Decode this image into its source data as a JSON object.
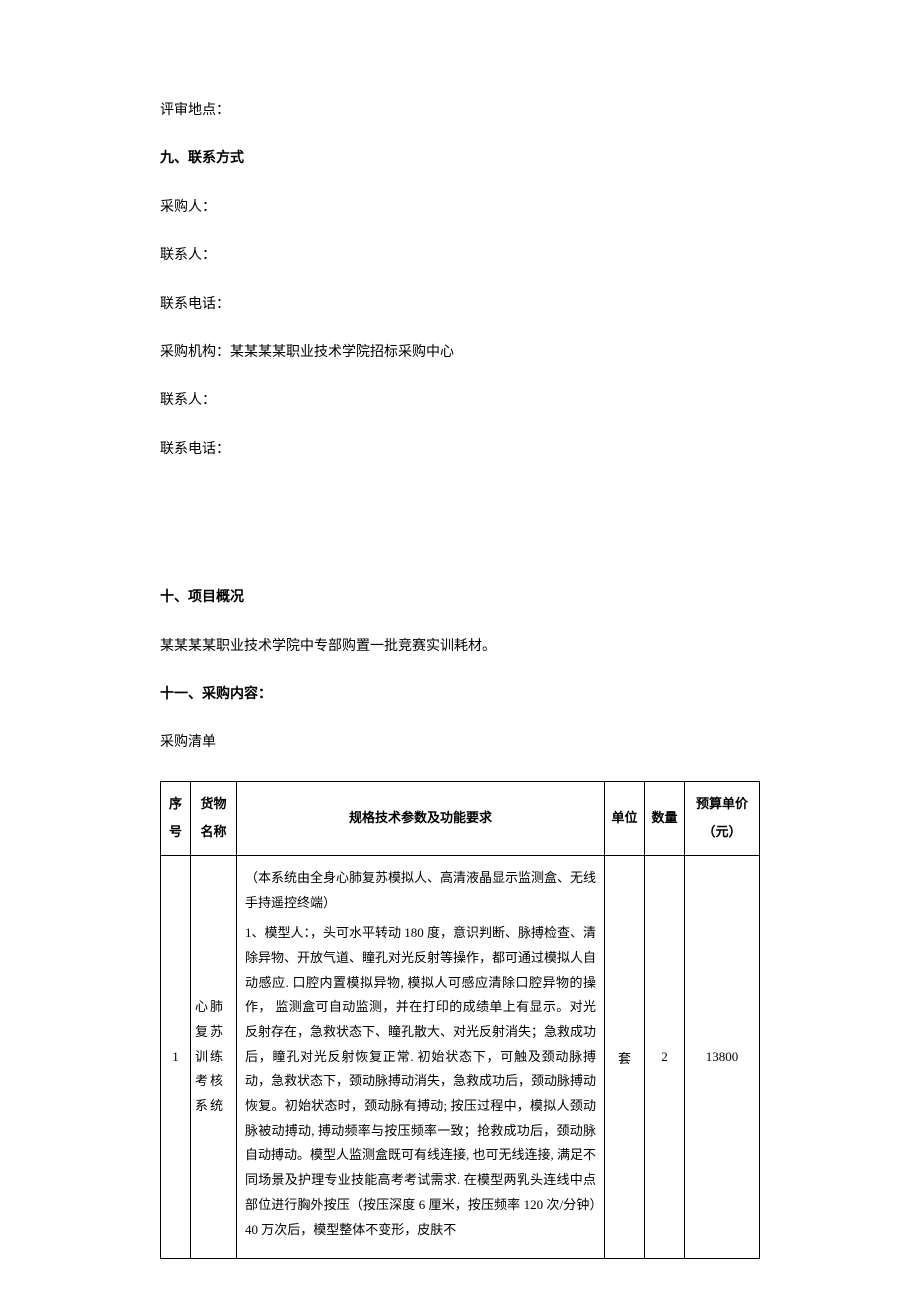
{
  "lines": {
    "review_location": "评审地点：",
    "contact_title": "九、联系方式",
    "purchaser": "采购人：",
    "contact_person_1": "联系人：",
    "contact_phone_1": "联系电话：",
    "purchasing_org": "采购机构：某某某某职业技术学院招标采购中心",
    "contact_person_2": "联系人：",
    "contact_phone_2": "联系电话：",
    "project_overview_title": "十、项目概况",
    "project_overview": "某某某某职业技术学院中专部购置一批竞赛实训耗材。",
    "purchase_content_title": "十一、采购内容：",
    "purchase_list": "采购清单"
  },
  "table": {
    "headers": {
      "seq": "序号",
      "name": "货物名称",
      "spec": "规格技术参数及功能要求",
      "unit": "单位",
      "qty": "数量",
      "price": "预算单价（元）"
    },
    "rows": [
      {
        "seq": "1",
        "name": "心肺复苏训练考核系统",
        "spec_p1": "（本系统由全身心肺复苏模拟人、高清液晶显示监测盒、无线手持遥控终端）",
        "spec_p2": "1、模型人：，头可水平转动 180 度，意识判断、脉搏检查、清除异物、开放气道、瞳孔对光反射等操作，都可通过模拟人自动感应. 口腔内置模拟异物, 模拟人可感应清除口腔异物的操作， 监测盒可自动监测，并在打印的成绩单上有显示。对光反射存在，急救状态下、瞳孔散大、对光反射消失；急救成功后，瞳孔对光反射恢复正常. 初始状态下，可触及颈动脉搏动，急救状态下，颈动脉搏动消失，急救成功后，颈动脉搏动恢复。初始状态时，颈动脉有搏动; 按压过程中，模拟人颈动脉被动搏动, 搏动频率与按压频率一致；抢救成功后，颈动脉自动搏动。模型人监测盒既可有线连接, 也可无线连接, 满足不同场景及护理专业技能高考考试需求. 在模型两乳头连线中点部位进行胸外按压（按压深度 6 厘米，按压频率 120 次/分钟）40 万次后，模型整体不变形，皮肤不",
        "unit": "套",
        "qty": "2",
        "price": "13800"
      }
    ]
  }
}
